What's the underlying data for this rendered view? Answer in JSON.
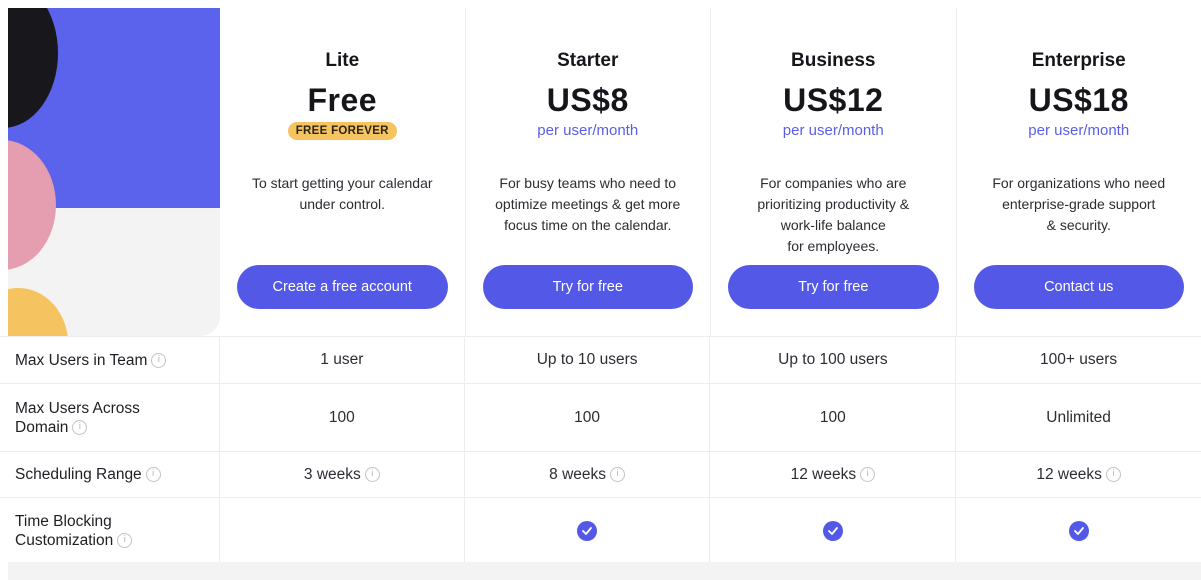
{
  "colors": {
    "accent": "#5359e6",
    "badge": "#f5c35f"
  },
  "plans": [
    {
      "name": "Lite",
      "price": "Free",
      "badge": "FREE FOREVER",
      "description": "To start getting your calendar\nunder control.",
      "cta": "Create a free account"
    },
    {
      "name": "Starter",
      "price": "US$8",
      "period": "per user/month",
      "description": "For busy teams who need to\noptimize meetings & get more\nfocus time on the calendar.",
      "cta": "Try for free"
    },
    {
      "name": "Business",
      "price": "US$12",
      "period": "per user/month",
      "description": "For companies who are\nprioritizing productivity &\nwork-life balance\nfor employees.",
      "cta": "Try for free"
    },
    {
      "name": "Enterprise",
      "price": "US$18",
      "period": "per user/month",
      "description": "For organizations who need\nenterprise-grade support\n& security.",
      "cta": "Contact us"
    }
  ],
  "features": [
    {
      "label": "Max Users in Team",
      "values": [
        "1 user",
        "Up to 10 users",
        "Up to 100 users",
        "100+ users"
      ]
    },
    {
      "label": "Max Users Across Domain",
      "values": [
        "100",
        "100",
        "100",
        "Unlimited"
      ]
    },
    {
      "label": "Scheduling Range",
      "values": [
        "3 weeks",
        "8 weeks",
        "12 weeks",
        "12 weeks"
      ]
    },
    {
      "label": "Time Blocking Customization",
      "values": [
        "",
        "check",
        "check",
        "check"
      ]
    }
  ],
  "icons": {
    "info": "info-icon",
    "check": "check-icon"
  }
}
